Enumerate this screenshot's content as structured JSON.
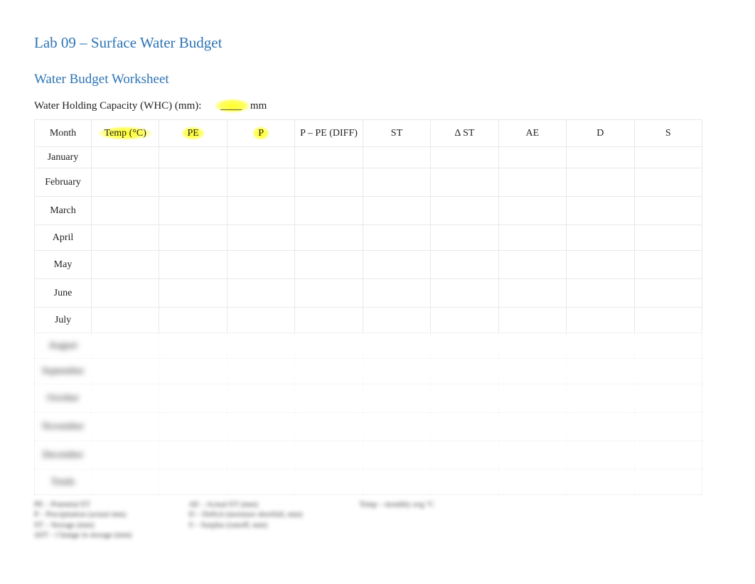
{
  "titles": {
    "main": "Lab 09 – Surface Water Budget",
    "sub": "Water Budget Worksheet"
  },
  "whc": {
    "label": "Water Holding Capacity (WHC) (mm):",
    "blank": "____",
    "unit": "mm"
  },
  "headers": {
    "month": "Month",
    "temp": "Temp (°C)",
    "pe": "PE",
    "p": "P",
    "diff": "P – PE (DIFF)",
    "st": "ST",
    "dst": "Δ ST",
    "ae": "AE",
    "d": "D",
    "s": "S"
  },
  "months": {
    "jan": "January",
    "feb": "February",
    "mar": "March",
    "apr": "April",
    "may": "May",
    "jun": "June",
    "jul": "July",
    "aug": "August",
    "sep": "September",
    "oct": "October",
    "nov": "November",
    "dec": "December",
    "totals": "Totals"
  },
  "legend": {
    "col1": {
      "l1": "PE – Potential ET",
      "l2": "P – Precipitation (actual mm)",
      "l3": "ST – Storage (mm)",
      "l4": "ΔST – Change in storage (mm)"
    },
    "col2": {
      "l1": "AE – Actual ET (mm)",
      "l2": "D – Deficit (moisture shortfall, mm)",
      "l3": "S – Surplus (runoff, mm)"
    },
    "col3": {
      "l1": "Temp – monthly avg °C"
    }
  }
}
